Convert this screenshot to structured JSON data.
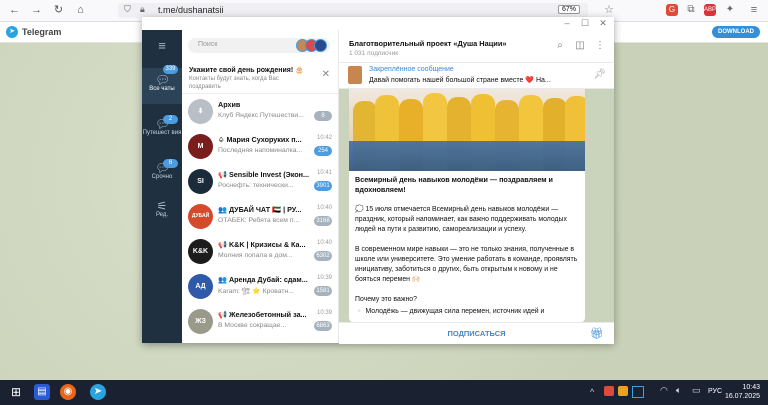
{
  "browser": {
    "url": "t.me/dushanatsii",
    "zoom": "67%"
  },
  "tg_web": {
    "name": "Telegram",
    "download": "DOWNLOAD"
  },
  "sidebar": {
    "items": [
      {
        "label": "Все чаты",
        "badge": "339"
      },
      {
        "label": "Путешест вия",
        "badge": "2"
      },
      {
        "label": "Срочно",
        "badge": "6"
      },
      {
        "label": "Ред.",
        "badge": ""
      }
    ]
  },
  "chatlist": {
    "search_placeholder": "Поиск",
    "birthday": {
      "title": "Укажите свой день рождения! 🎂",
      "subtitle": "Контакты будут знать, когда Вас поздравить"
    },
    "chats": [
      {
        "title": "Архив",
        "message": "Клуб Яндекс Путешестви...",
        "time": "",
        "badge": "8",
        "avatar_color": "#b8bfc6",
        "avatar_text": "⬇"
      },
      {
        "title": "♤ Мария Сухоруких п...",
        "message": "Последняя напоминалка...",
        "time": "10:42",
        "badge": "254",
        "avatar_color": "#7a1d1d",
        "avatar_text": "М"
      },
      {
        "title": "📢 Sensible Invest (Экон...",
        "message": "Роснефть: технически...",
        "time": "10:41",
        "badge": "3901",
        "avatar_color": "#1b2b3a",
        "avatar_text": "SI"
      },
      {
        "title": "👥 ДУБАЙ ЧАТ 🇦🇪 | РУ...",
        "message": "ОТАБЕК: Ребята всем п...",
        "time": "10:40",
        "badge": "3168",
        "avatar_color": "#d44a2a",
        "avatar_text": "ДУБАЙ"
      },
      {
        "title": "📢 K&K | Кризисы & Ка...",
        "message": "Молния попала в дом...",
        "time": "10:40",
        "badge": "6302",
        "avatar_color": "#1c1c1c",
        "avatar_text": "K&K"
      },
      {
        "title": "👥 Аренда Дубай: сдам...",
        "message": "Karam: 🏗 ⭐ Кроватн...",
        "time": "10:39",
        "badge": "1581",
        "avatar_color": "#2f5aa8",
        "avatar_text": "АД"
      },
      {
        "title": "📢 Железобетонный за...",
        "message": "В Москве сокращае...",
        "time": "10:39",
        "badge": "6863",
        "avatar_color": "#9a9a8a",
        "avatar_text": "ЖЗ"
      }
    ]
  },
  "chat": {
    "title": "Благотворительный проект «Душа Нации»",
    "subscribers": "1 031 подписчик",
    "pinned_title": "Закреплённое сообщение",
    "pinned_text": "Давай помогать нашей большой стране вместе ❤️  На...",
    "post_title": "Всемирный день навыков молодёжи — поздравляем и вдохновляем!",
    "paragraphs": [
      "💭 15 июля отмечается Всемирный день навыков молодёжи — праздник, который напоминает, как важно поддерживать молодых людей на пути к развитию, самореализации и успеху.",
      "В современном мире навыки — это не только знания, полученные в школе или университете. Это умение работать в команде, проявлять инициативу, заботиться о других, быть открытым к новому и не бояться перемен 🙌🏻",
      "Почему это важно?",
      "▫️ Молодёжь — движущая сила перемен, источник идей и"
    ],
    "subscribe": "ПОДПИСАТЬСЯ"
  },
  "taskbar": {
    "lang": "РУС",
    "time": "10:43",
    "date": "16.07.2025"
  }
}
